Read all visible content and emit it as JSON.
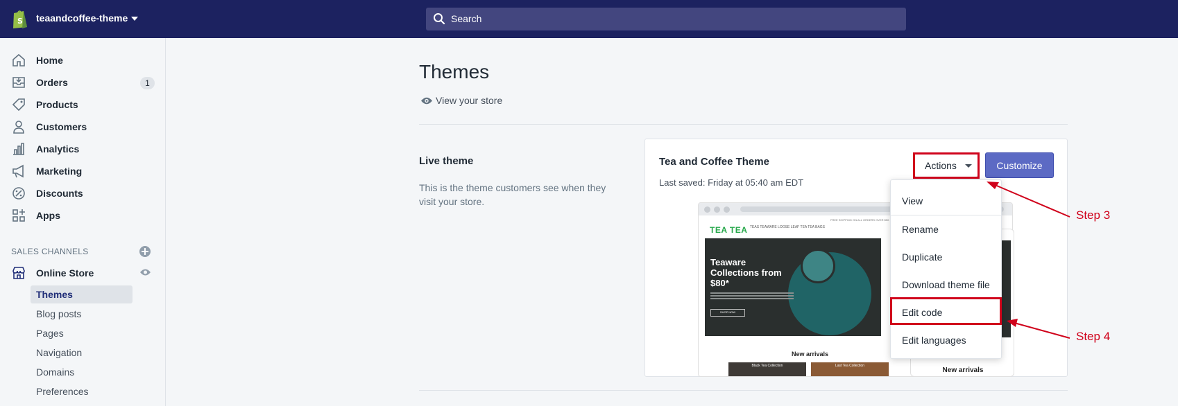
{
  "topbar": {
    "store_name": "teaandcoffee-theme",
    "search_placeholder": "Search"
  },
  "sidebar": {
    "items": [
      {
        "label": "Home"
      },
      {
        "label": "Orders",
        "badge": "1"
      },
      {
        "label": "Products"
      },
      {
        "label": "Customers"
      },
      {
        "label": "Analytics"
      },
      {
        "label": "Marketing"
      },
      {
        "label": "Discounts"
      },
      {
        "label": "Apps"
      }
    ],
    "sales_channels_title": "SALES CHANNELS",
    "online_store": "Online Store",
    "sub_items": [
      {
        "label": "Themes"
      },
      {
        "label": "Blog posts"
      },
      {
        "label": "Pages"
      },
      {
        "label": "Navigation"
      },
      {
        "label": "Domains"
      },
      {
        "label": "Preferences"
      }
    ]
  },
  "main": {
    "title": "Themes",
    "view_store": "View your store",
    "live_theme": {
      "title": "Live theme",
      "description": "This is the theme customers see when they visit your store."
    },
    "card": {
      "theme_name": "Tea and Coffee Theme",
      "last_saved": "Last saved: Friday at 05:40 am EDT",
      "actions_label": "Actions",
      "customize_label": "Customize"
    },
    "preview": {
      "logo": "TEA TEA",
      "nav": "TEAS   TEAWARE   LOOSE LEAF TEA   TEA BAGS",
      "top_bar": "FREE SHIPPING ON ALL ORDERS OVER $50",
      "hero_title": "Teaware Collections from $80*",
      "hero_button": "SHOP NOW",
      "new_arrivals": "New arrivals",
      "thumb_a": "Black Tea Collection",
      "thumb_b": "Last Tea Collection"
    }
  },
  "dropdown": {
    "items": [
      {
        "label": "View"
      },
      {
        "label": "Rename"
      },
      {
        "label": "Duplicate"
      },
      {
        "label": "Download theme file"
      },
      {
        "label": "Edit code"
      },
      {
        "label": "Edit languages"
      }
    ]
  },
  "annotations": {
    "step3": "Step 3",
    "step4": "Step 4",
    "color": "#d0021b"
  },
  "colors": {
    "topbar": "#1c2260",
    "accent": "#5c6ac4",
    "highlight": "#d0021b"
  }
}
